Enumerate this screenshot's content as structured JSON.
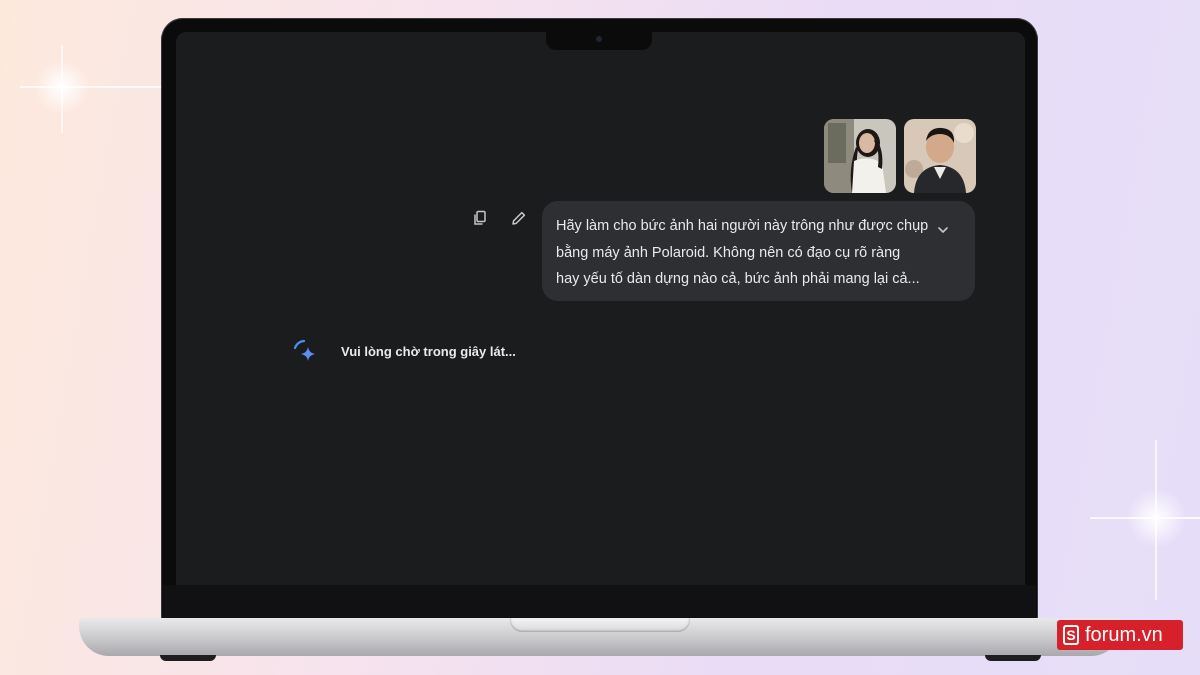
{
  "chat": {
    "user_message_lines": [
      "Hãy làm cho bức ảnh hai người này trông như được chụp",
      "bằng máy ảnh Polaroid. Không nên có đạo cụ rõ ràng",
      "hay yếu tố dàn dựng nào cả, bức ảnh phải mang lại cả..."
    ],
    "attachments": [
      "photo-woman",
      "photo-man"
    ],
    "loading_text": "Vui lòng chờ trong giây lát..."
  },
  "icons": {
    "copy": "copy-icon",
    "edit": "pencil-edit-icon",
    "expand": "chevron-down-icon",
    "loading": "sparkle-spinner-icon"
  },
  "brand": {
    "name": "forum.vn",
    "logo_letter": "S"
  },
  "colors": {
    "screen_bg": "#1b1c1e",
    "bubble_bg": "#2d2f32",
    "text": "#e8eaed",
    "accent": "#4c8df6",
    "brand": "#d6202a"
  }
}
